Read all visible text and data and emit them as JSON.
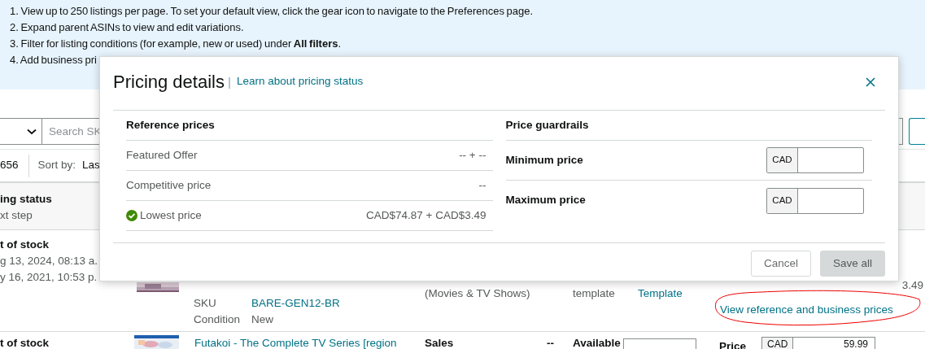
{
  "banner": {
    "lines": [
      "1. View up to 250 listings per page. To set your default view, click the gear icon to navigate to the Preferences page.",
      "2. Expand parent ASINs to view and edit variations.",
      "3. Filter for listing conditions (for example, new or used) under **All filters**.",
      "4. Add business pri"
    ]
  },
  "toolbar": {
    "search": {
      "placeholder": "Search SK"
    }
  },
  "summary": {
    "count": "656",
    "sort_label": "Sort by:",
    "sort_value": "Las"
  },
  "table": {
    "header": [
      "ing status",
      "xt step"
    ],
    "rows": [
      {
        "status": "t of stock",
        "dates": [
          "g 13, 2024, 08:13 a.",
          "y 16, 2021, 10:53 p."
        ],
        "details": [
          {
            "label": "SKU",
            "value": "BARE-GEN12-BR",
            "kind": "link"
          },
          {
            "label": "Condition",
            "value": "New",
            "kind": "text"
          }
        ],
        "category": "(Movies & TV Shows)",
        "shipping": "template",
        "shipping_link": "Template",
        "price_tail": "3.49",
        "price_link": "View reference and business prices"
      },
      {
        "status": "t of stock",
        "title": "Futakoi - The Complete TV Series [region",
        "sales_label": "Sales",
        "sales_value": "--",
        "available_label": "Available",
        "price_label": "Price",
        "currency": "CAD",
        "price": "59.99"
      }
    ]
  },
  "modal": {
    "title": "Pricing details",
    "link": "Learn about pricing status",
    "reference": {
      "heading": "Reference prices",
      "rows": [
        {
          "label": "Featured Offer",
          "value": "-- + --",
          "checked": false
        },
        {
          "label": "Competitive price",
          "value": "--",
          "checked": false
        },
        {
          "label": "Lowest price",
          "value": "CAD$74.87 + CAD$3.49",
          "checked": true
        }
      ]
    },
    "guardrails": {
      "heading": "Price guardrails",
      "fields": [
        {
          "label": "Minimum price",
          "currency": "CAD"
        },
        {
          "label": "Maximum price",
          "currency": "CAD"
        }
      ]
    },
    "buttons": [
      {
        "label": "Cancel",
        "disabled": false
      },
      {
        "label": "Save all",
        "disabled": true
      }
    ]
  }
}
